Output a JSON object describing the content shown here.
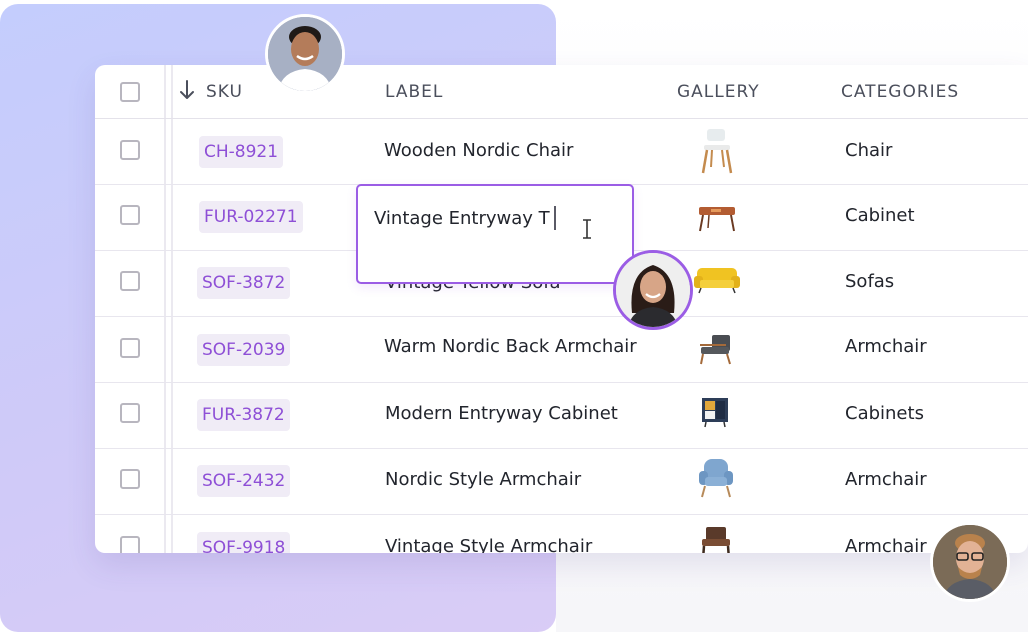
{
  "table": {
    "columns": {
      "sku": "SKU",
      "label": "LABEL",
      "gallery": "GALLERY",
      "categories": "CATEGORIES"
    },
    "sort_icon": "arrow-down-icon",
    "rows": [
      {
        "sku": "CH-8921",
        "label": "Wooden Nordic Chair",
        "category": "Chair",
        "thumb": "chair-thumbnail"
      },
      {
        "sku": "FUR-02271",
        "label": "",
        "category": "Cabinet",
        "thumb": "entry-table-thumbnail"
      },
      {
        "sku": "SOF-3872",
        "label": "Vintage Yellow Sofa",
        "category": "Sofas",
        "thumb": "yellow-sofa-thumbnail"
      },
      {
        "sku": "SOF-2039",
        "label": "Warm Nordic Back Armchair",
        "category": "Armchair",
        "thumb": "armchair-thumbnail"
      },
      {
        "sku": "FUR-3872",
        "label": "Modern Entryway Cabinet",
        "category": "Cabinets",
        "thumb": "cabinet-thumbnail"
      },
      {
        "sku": "SOF-2432",
        "label": "Nordic Style Armchair",
        "category": "Armchair",
        "thumb": "blue-armchair-thumbnail"
      },
      {
        "sku": "SOF-9918",
        "label": "Vintage Style Armchair",
        "category": "Armchair",
        "thumb": "vintage-armchair-thumbnail"
      }
    ]
  },
  "editor": {
    "value": "Vintage Entryway T"
  },
  "colors": {
    "accent": "#9b5de5",
    "sku_text": "#8e4fd6",
    "sku_chip_bg": "#f0ecf6",
    "panel_gradient_start": "#c4cdfd",
    "panel_gradient_end": "#d9ccf6"
  }
}
